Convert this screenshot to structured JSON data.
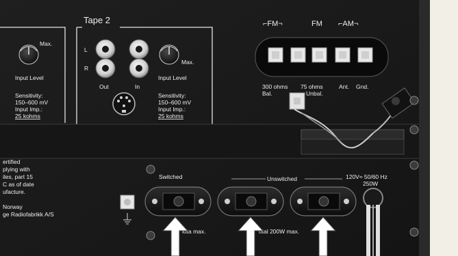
{
  "panel": {
    "tape2_title": "Tape 2",
    "left_jacks": {
      "knob_label": "Max.",
      "input_level": "Input Level",
      "sensitivity": "Sensitivity:",
      "sensitivity_range": "150–600 mV",
      "input_imp": "Input Imp.:",
      "impedance": "25 kohms"
    },
    "tape2": {
      "channel_l": "L",
      "channel_r": "R",
      "out_label": "Out",
      "in_label": "In",
      "knob_label": "Max.",
      "input_level": "Input Level",
      "sensitivity": "Sensitivity:",
      "sensitivity_range": "150–600 mV",
      "input_imp": "Input Imp.:",
      "impedance": "25 kohms"
    },
    "antenna": {
      "fm_group": "⌐FM¬",
      "fm": "FM",
      "am_group": "⌐AM¬",
      "terminal_300": "300 ohms",
      "terminal_300_sub": "Bal.",
      "terminal_75": "75 ohms",
      "terminal_75_sub": "Unbal.",
      "ant": "Ant.",
      "gnd": "Gnd."
    },
    "compliance_text": [
      "ertified",
      "plying with",
      "iles, part 15",
      "C as of date",
      "ufacture.",
      "",
      "Norway",
      "ge Radiofabrikk A/S"
    ],
    "power": {
      "switched": "Switched",
      "unswitched": "Unswitched",
      "mains": "120V≈ 50/60 Hz",
      "watts": "250W",
      "switched_max": "lota max.",
      "unswitched_max": "otal 200W max."
    }
  }
}
